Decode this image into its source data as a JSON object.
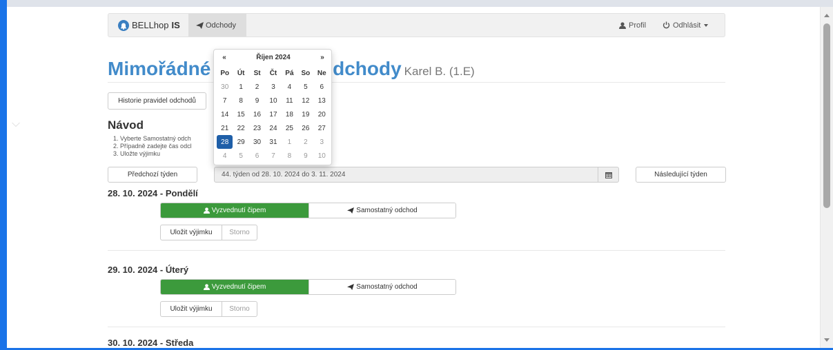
{
  "navbar": {
    "brand_name": "BELLhop",
    "brand_suffix": "IS",
    "nav_odchody": "Odchody",
    "profil": "Profil",
    "logout": "Odhlásit"
  },
  "title": {
    "part1": "Mimořádné",
    "part2": "odchody",
    "student": "Karel B. (1.E)"
  },
  "history_button": "Historie pravidel odchodů",
  "navod": {
    "heading": "Návod",
    "items": [
      "1. Vyberte Samostatný odch",
      "2. Případně zadejte čas odcl",
      "3. Uložte výjimku"
    ]
  },
  "week_nav": {
    "prev": "Předchozí týden",
    "range": "44. týden od 28. 10. 2024 do 3. 11. 2024",
    "next": "Následující týden"
  },
  "days": [
    {
      "heading": "28. 10. 2024 - Pondělí",
      "on_label": "Vyzvednutí čipem",
      "off_label": "Samostatný odchod",
      "save": "Uložit výjimku",
      "storno": "Storno"
    },
    {
      "heading": "29. 10. 2024 - Úterý",
      "on_label": "Vyzvednutí čipem",
      "off_label": "Samostatný odchod",
      "save": "Uložit výjimku",
      "storno": "Storno"
    },
    {
      "heading": "30. 10. 2024 - Středa"
    }
  ],
  "datepicker": {
    "prev": "«",
    "month": "Říjen 2024",
    "next": "»",
    "weekdays": [
      "Po",
      "Út",
      "St",
      "Čt",
      "Pá",
      "So",
      "Ne"
    ],
    "weeks": [
      [
        "30",
        "1",
        "2",
        "3",
        "4",
        "5",
        "6"
      ],
      [
        "7",
        "8",
        "9",
        "10",
        "11",
        "12",
        "13"
      ],
      [
        "14",
        "15",
        "16",
        "17",
        "18",
        "19",
        "20"
      ],
      [
        "21",
        "22",
        "23",
        "24",
        "25",
        "26",
        "27"
      ],
      [
        "28",
        "29",
        "30",
        "31",
        "1",
        "2",
        "3"
      ],
      [
        "4",
        "5",
        "6",
        "7",
        "8",
        "9",
        "10"
      ]
    ],
    "selected": "28"
  },
  "colors": {
    "primary": "#428bca",
    "success": "#3c9a3c",
    "selected_day": "#1f5fa8"
  }
}
